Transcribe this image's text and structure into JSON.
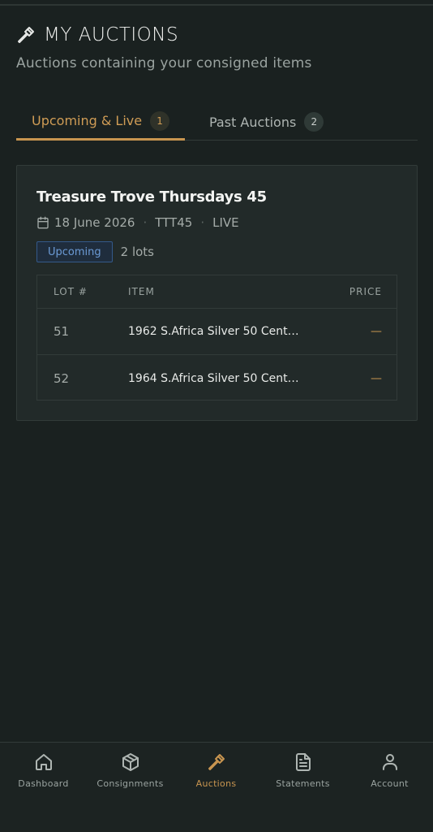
{
  "header": {
    "title": "MY AUCTIONS",
    "subtitle": "Auctions containing your consigned items",
    "icon": "gavel-icon"
  },
  "tabs": [
    {
      "label": "Upcoming & Live",
      "count": "1",
      "active": true
    },
    {
      "label": "Past Auctions",
      "count": "2",
      "active": false
    }
  ],
  "auction": {
    "title": "Treasure Trove Thursdays 45",
    "date": "18 June 2026",
    "code": "TTT45",
    "mode": "LIVE",
    "status": "Upcoming",
    "lots_count": "2 lots",
    "table": {
      "headers": {
        "lot": "LOT #",
        "item": "ITEM",
        "price": "PRICE"
      },
      "rows": [
        {
          "lot": "51",
          "item": "1962 S.Africa Silver 50 Cent…",
          "price": "—"
        },
        {
          "lot": "52",
          "item": "1964 S.Africa Silver 50 Cent…",
          "price": "—"
        }
      ]
    }
  },
  "nav": [
    {
      "label": "Dashboard",
      "icon": "home-icon",
      "active": false
    },
    {
      "label": "Consignments",
      "icon": "box-icon",
      "active": false
    },
    {
      "label": "Auctions",
      "icon": "gavel-icon",
      "active": true
    },
    {
      "label": "Statements",
      "icon": "document-icon",
      "active": false
    },
    {
      "label": "Account",
      "icon": "user-icon",
      "active": false
    }
  ],
  "colors": {
    "background": "#1a2120",
    "accent": "#c89550",
    "badge_blue": "#6c9bd6"
  }
}
